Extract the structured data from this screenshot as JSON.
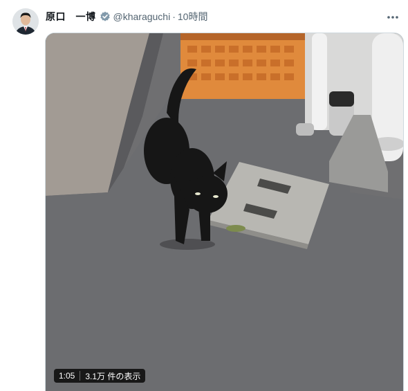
{
  "tweet": {
    "author": {
      "display_name": "原口　一博",
      "handle": "@kharaguchi",
      "verified": true
    },
    "separator": "·",
    "timestamp": "10時間",
    "more_icon": "more-horizontal-icon",
    "media": {
      "type": "video",
      "duration": "1:05",
      "views": "3.1万 件の表示"
    }
  }
}
